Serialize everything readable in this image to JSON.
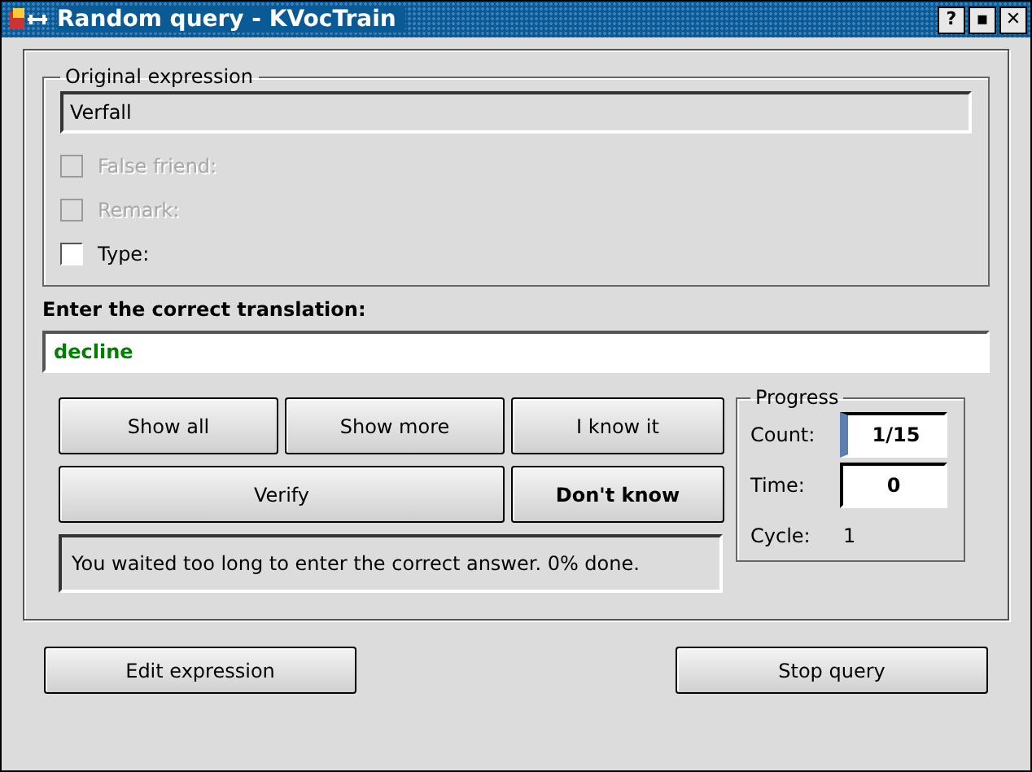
{
  "window": {
    "title": "Random query - KVocTrain",
    "buttons": [
      "?",
      "▪",
      "✕"
    ]
  },
  "original": {
    "legend": "Original expression",
    "value": "Verfall"
  },
  "options": [
    {
      "label": "False friend:",
      "checked": false,
      "disabled": true
    },
    {
      "label": "Remark:",
      "checked": false,
      "disabled": true
    },
    {
      "label": "Type:",
      "checked": false,
      "disabled": false
    }
  ],
  "translation": {
    "label": "Enter the correct translation:",
    "value": "decline"
  },
  "actions": [
    {
      "label": "Show all",
      "default": false,
      "wide": false
    },
    {
      "label": "Show more",
      "default": false,
      "wide": false
    },
    {
      "label": "I know it",
      "default": false,
      "wide": false
    },
    {
      "label": "Verify",
      "default": false,
      "wide": true
    },
    {
      "label": "Don't know",
      "default": true,
      "wide": false
    }
  ],
  "message": "You waited too long to enter the correct answer. 0% done.",
  "progress": {
    "legend": "Progress",
    "rows": [
      {
        "label": "Count:",
        "value": "1/15",
        "kind": "field",
        "focused": true
      },
      {
        "label": "Time:",
        "value": "0",
        "kind": "field",
        "focused": false
      },
      {
        "label": "Cycle:",
        "value": "1",
        "kind": "text"
      }
    ]
  },
  "footer": [
    "Edit expression",
    "Stop query"
  ]
}
